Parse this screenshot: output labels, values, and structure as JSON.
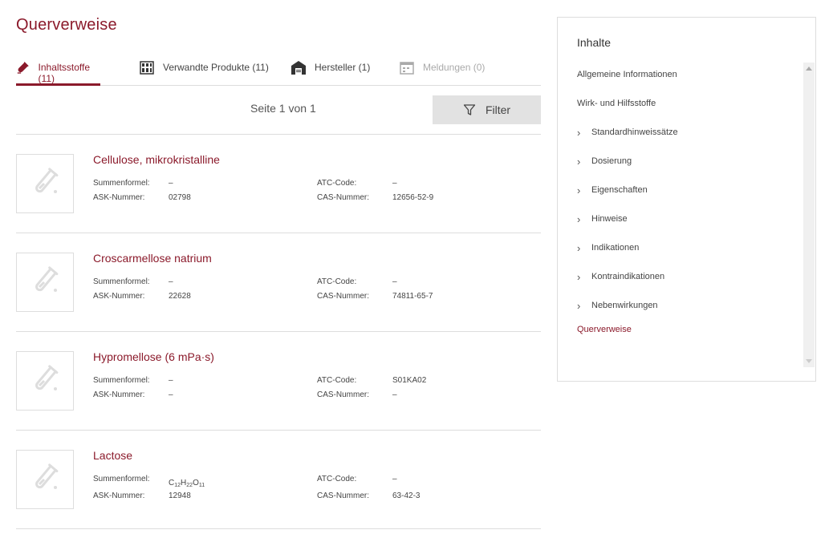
{
  "page_title": "Querverweise",
  "tabs": [
    {
      "label": "Inhaltsstoffe (11)",
      "icon": "test-tube-icon",
      "state": "active"
    },
    {
      "label": "Verwandte Produkte (11)",
      "icon": "product-grid-icon",
      "state": "normal"
    },
    {
      "label": "Hersteller (1)",
      "icon": "factory-icon",
      "state": "normal"
    },
    {
      "label": "Meldungen (0)",
      "icon": "calendar-icon",
      "state": "disabled"
    }
  ],
  "pager": {
    "info": "Seite 1 von 1",
    "filter_label": "Filter"
  },
  "field_labels": {
    "formula": "Summenformel:",
    "ask": "ASK-Nummer:",
    "atc": "ATC-Code:",
    "cas": "CAS-Nummer:"
  },
  "substances": [
    {
      "name": "Cellulose, mikrokristalline",
      "formula": "–",
      "ask": "02798",
      "atc": "–",
      "cas": "12656-52-9"
    },
    {
      "name": "Croscarmellose natrium",
      "formula": "–",
      "ask": "22628",
      "atc": "–",
      "cas": "74811-65-7"
    },
    {
      "name": "Hypromellose (6 mPa·s)",
      "formula": "–",
      "ask": "–",
      "atc": "S01KA02",
      "cas": "–"
    },
    {
      "name": "Lactose",
      "formula_parts": [
        "C",
        "12",
        "H",
        "22",
        "O",
        "11"
      ],
      "ask": "12948",
      "atc": "–",
      "cas": "63-42-3"
    }
  ],
  "sidebar": {
    "title": "Inhalte",
    "items": [
      {
        "label": "Allgemeine Informationen",
        "expandable": false,
        "active": false
      },
      {
        "label": "Wirk- und Hilfsstoffe",
        "expandable": false,
        "active": false
      },
      {
        "label": "Standardhinweissätze",
        "expandable": true,
        "active": false
      },
      {
        "label": "Dosierung",
        "expandable": true,
        "active": false
      },
      {
        "label": "Eigenschaften",
        "expandable": true,
        "active": false
      },
      {
        "label": "Hinweise",
        "expandable": true,
        "active": false
      },
      {
        "label": "Indikationen",
        "expandable": true,
        "active": false
      },
      {
        "label": "Kontraindikationen",
        "expandable": true,
        "active": false
      },
      {
        "label": "Nebenwirkungen",
        "expandable": true,
        "active": false
      },
      {
        "label": "Querverweise",
        "expandable": false,
        "active": true
      }
    ]
  },
  "colors": {
    "accent": "#8b1a2b",
    "divider": "#dddddd",
    "button_bg": "#e2e2e2"
  }
}
